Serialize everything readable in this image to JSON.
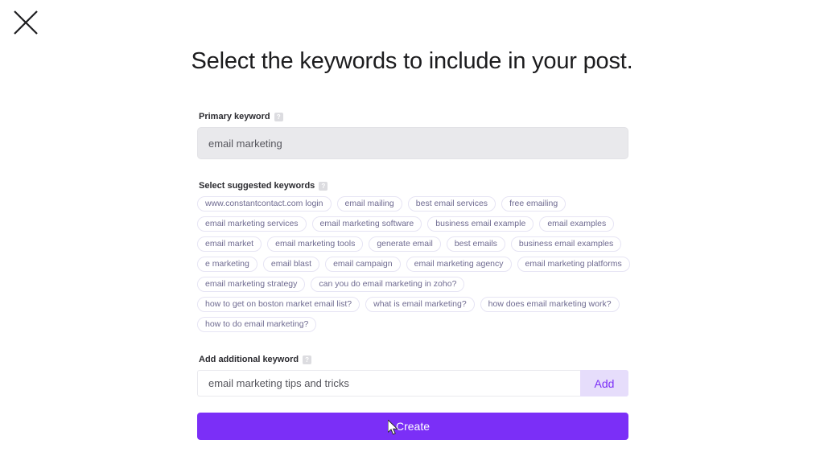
{
  "window": {
    "close_label": "✕"
  },
  "header": {
    "title": "Select the keywords to include in your post."
  },
  "primary_keyword": {
    "label": "Primary keyword",
    "help_glyph": "?",
    "value": "email marketing",
    "placeholder": "email marketing"
  },
  "suggested_keywords": {
    "label": "Select suggested keywords",
    "help_glyph": "?",
    "chips": [
      "www.constantcontact.com login",
      "email mailing",
      "best email services",
      "free emailing",
      "email marketing services",
      "email marketing software",
      "business email example",
      "email examples",
      "email market",
      "email marketing tools",
      "generate email",
      "best emails",
      "business email examples",
      "e marketing",
      "email blast",
      "email campaign",
      "email marketing agency",
      "email marketing platforms",
      "email marketing strategy",
      "can you do email marketing in zoho?",
      "how to get on boston market email list?",
      "what is email marketing?",
      "how does email marketing work?",
      "how to do email marketing?"
    ]
  },
  "additional_keyword": {
    "label": "Add additional keyword",
    "help_glyph": "?",
    "value": "email marketing tips and tricks",
    "placeholder": "Add additional keyword",
    "add_label": "Add"
  },
  "footer": {
    "create_label": "Create"
  },
  "colors": {
    "accent": "#7b2ff7",
    "accent_soft": "#e6ddfb",
    "chip_border": "#e6e4f4",
    "chip_text": "#6f6b91",
    "disabled_field": "#e9e9ec",
    "title_text": "#1c1c1e"
  }
}
